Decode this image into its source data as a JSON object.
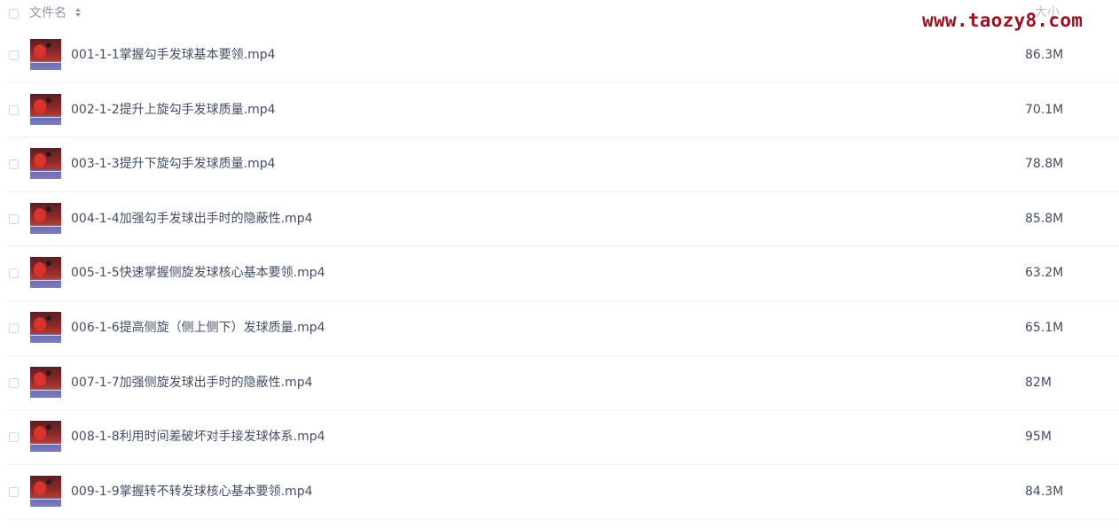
{
  "header": {
    "name_label": "文件名",
    "size_label": "大小"
  },
  "watermark": "www.taozy8.com",
  "files": [
    {
      "name": "001-1-1掌握勾手发球基本要领.mp4",
      "size": "86.3M"
    },
    {
      "name": "002-1-2提升上旋勾手发球质量.mp4",
      "size": "70.1M"
    },
    {
      "name": "003-1-3提升下旋勾手发球质量.mp4",
      "size": "78.8M"
    },
    {
      "name": "004-1-4加强勾手发球出手时的隐蔽性.mp4",
      "size": "85.8M"
    },
    {
      "name": "005-1-5快速掌握侧旋发球核心基本要领.mp4",
      "size": "63.2M"
    },
    {
      "name": "006-1-6提高侧旋（侧上侧下）发球质量.mp4",
      "size": "65.1M"
    },
    {
      "name": "007-1-7加强侧旋发球出手时的隐蔽性.mp4",
      "size": "82M"
    },
    {
      "name": "008-1-8利用时间差破坏对手接发球体系.mp4",
      "size": "95M"
    },
    {
      "name": "009-1-9掌握转不转发球核心基本要领.mp4",
      "size": "84.3M"
    }
  ]
}
